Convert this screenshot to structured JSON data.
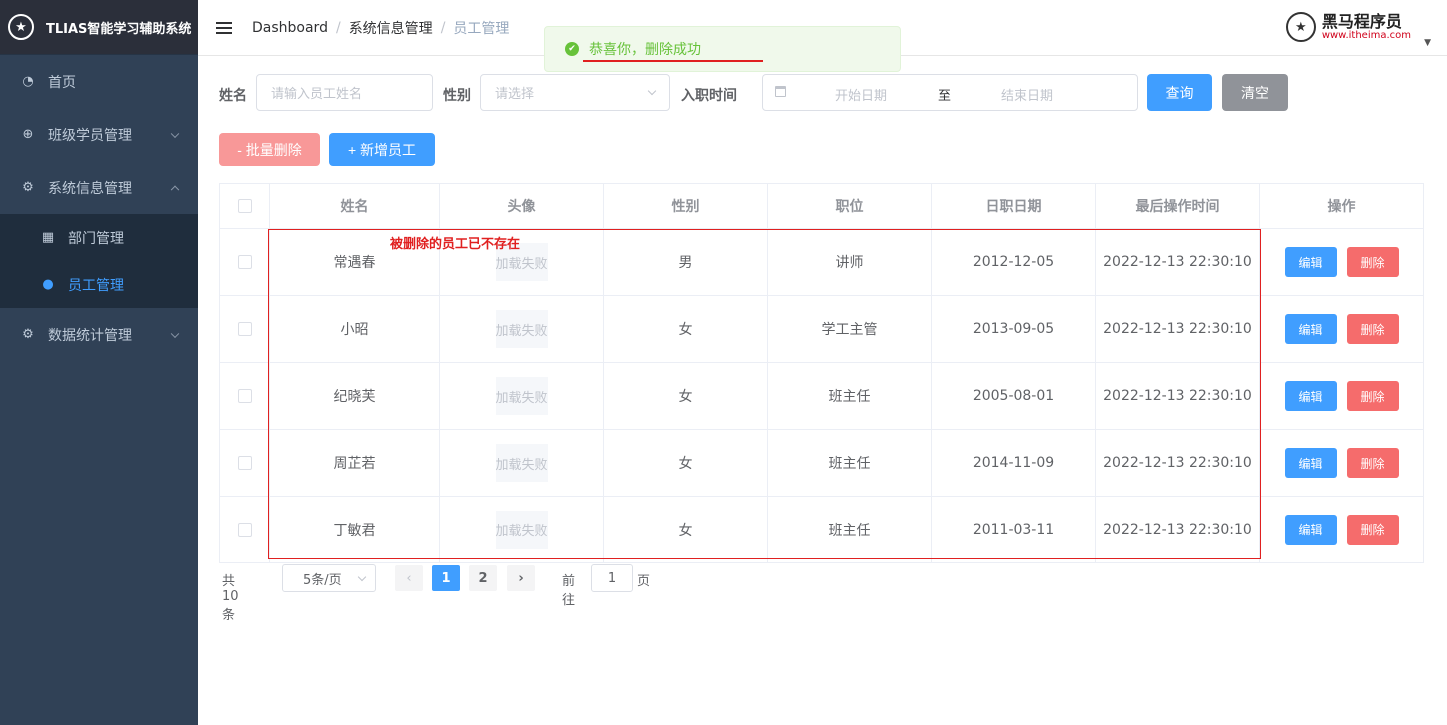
{
  "app": {
    "logo_glyph": "★",
    "title": "TLIAS智能学习辅助系统"
  },
  "sidebar": {
    "items": [
      {
        "icon": "dashboard-icon",
        "glyph": "◔",
        "label": "首页"
      },
      {
        "icon": "circle-plus-icon",
        "glyph": "⊕",
        "label": "班级学员管理"
      },
      {
        "icon": "gear-icon",
        "glyph": "⚙",
        "label": "系统信息管理"
      },
      {
        "icon": "grid-icon",
        "glyph": "▦",
        "label": "部门管理"
      },
      {
        "icon": "user-icon",
        "glyph": "●",
        "label": "员工管理"
      },
      {
        "icon": "gear-icon",
        "glyph": "⚙",
        "label": "数据统计管理"
      }
    ]
  },
  "header": {
    "breadcrumb": [
      "Dashboard",
      "系统信息管理",
      "员工管理"
    ],
    "separator": "/",
    "logo_glyph": "★",
    "logo_main": "黑马程序员",
    "logo_sub": "www.itheima.com",
    "caret": "▼"
  },
  "toast": {
    "icon": "✔",
    "message": "恭喜你，删除成功"
  },
  "search": {
    "name_label": "姓名",
    "name_placeholder": "请输入员工姓名",
    "gender_label": "性别",
    "gender_placeholder": "请选择",
    "date_label": "入职时间",
    "date_start": "开始日期",
    "date_sep": "至",
    "date_end": "结束日期",
    "query_label": "查询",
    "clear_label": "清空"
  },
  "actions": {
    "batch_delete": "- 批量删除",
    "add": "+ 新增员工"
  },
  "table": {
    "headers": [
      "姓名",
      "头像",
      "性别",
      "职位",
      "日职日期",
      "最后操作时间",
      "操作"
    ],
    "img_fail": "加载失败",
    "edit_label": "编辑",
    "delete_label": "删除",
    "rows": [
      {
        "name": "常遇春",
        "gender": "男",
        "job": "讲师",
        "entry": "2012-12-05",
        "updated": "2022-12-13 22:30:10"
      },
      {
        "name": "小昭",
        "gender": "女",
        "job": "学工主管",
        "entry": "2013-09-05",
        "updated": "2022-12-13 22:30:10"
      },
      {
        "name": "纪晓芙",
        "gender": "女",
        "job": "班主任",
        "entry": "2005-08-01",
        "updated": "2022-12-13 22:30:10"
      },
      {
        "name": "周芷若",
        "gender": "女",
        "job": "班主任",
        "entry": "2014-11-09",
        "updated": "2022-12-13 22:30:10"
      },
      {
        "name": "丁敏君",
        "gender": "女",
        "job": "班主任",
        "entry": "2011-03-11",
        "updated": "2022-12-13 22:30:10"
      }
    ]
  },
  "annotation": {
    "note": "被删除的员工已不存在",
    "color": "#e02020"
  },
  "pagination": {
    "total": "共 10 条",
    "page_size": "5条/页",
    "prev": "‹",
    "next": "›",
    "pages": [
      "1",
      "2"
    ],
    "current": "1",
    "goto_label": "前往",
    "goto_value": "1",
    "goto_unit": "页"
  },
  "colors": {
    "primary": "#409eff",
    "danger": "#f56c6c",
    "success": "#67c23a",
    "sidebar": "#304156"
  }
}
